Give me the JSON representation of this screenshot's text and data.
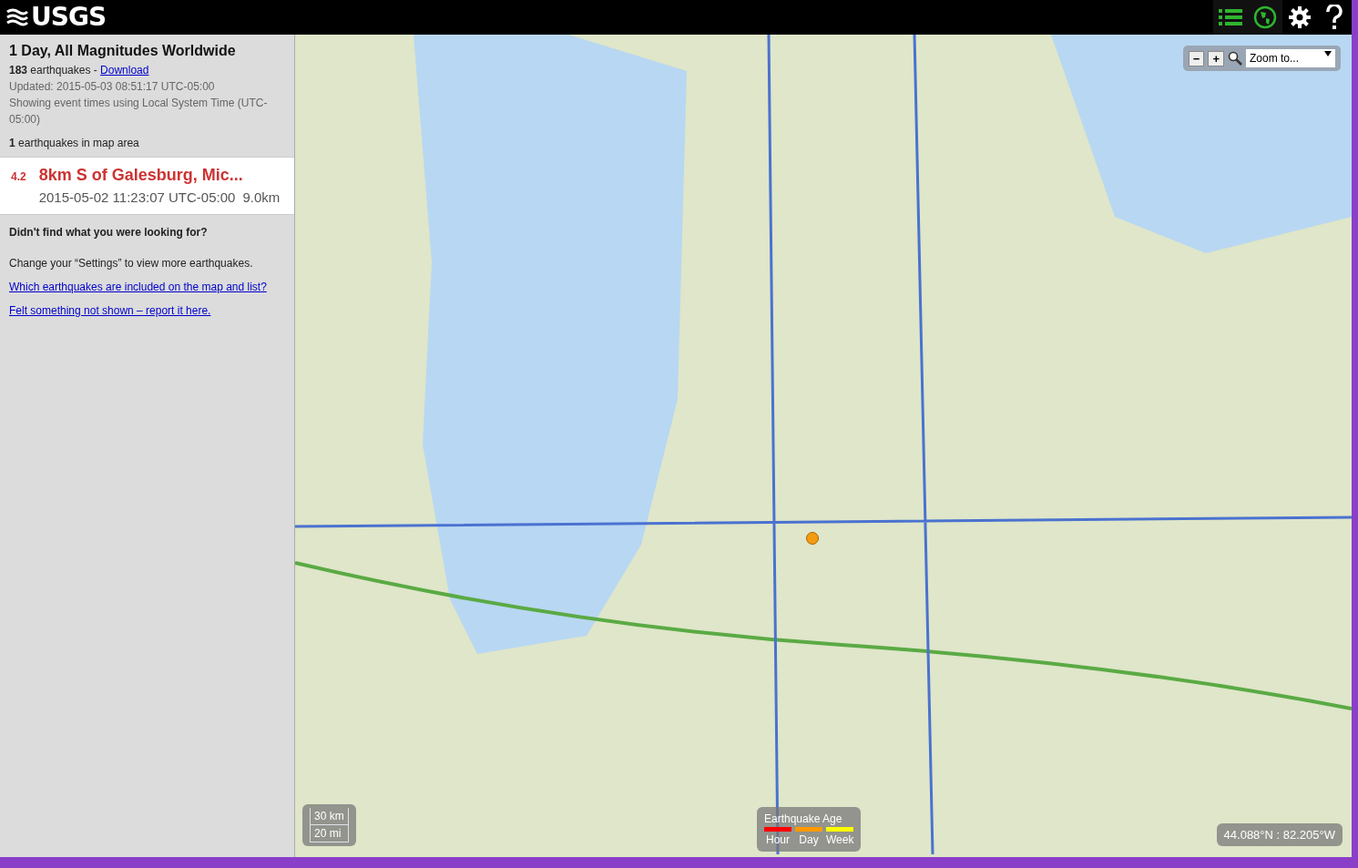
{
  "header": {
    "logo": "USGS",
    "buttons": [
      {
        "kind": "list",
        "active": true
      },
      {
        "kind": "globe",
        "active": true
      },
      {
        "kind": "settings",
        "active": false
      },
      {
        "kind": "help",
        "active": false
      }
    ]
  },
  "sidebar": {
    "title": "1 Day, All Magnitudes Worldwide",
    "count": "183",
    "count_label": "earthquakes - ",
    "download": "Download",
    "updated": "Updated: 2015-05-03 08:51:17 UTC-05:00",
    "time_note": "Showing event times using Local System Time (UTC-05:00)",
    "in_area_count": "1",
    "in_area_label": "earthquakes in map area",
    "events": [
      {
        "magnitude": "4.2",
        "title": "8km S of Galesburg, Mic...",
        "time": "2015-05-02 11:23:07 UTC-05:00",
        "depth": "9.0km",
        "selected": false
      }
    ],
    "help_title": "Didn't find what you were looking for?",
    "help_text": "Change your “Settings” to view more earthquakes.",
    "links": [
      "Which earthquakes are included on the map and list?",
      "Felt something not shown – report it here."
    ]
  },
  "map": {
    "zoom_out": "−",
    "zoom_in": "+",
    "zoom_select": "Zoom to...",
    "scale": [
      "30 km",
      "20 mi"
    ],
    "legend": {
      "title": "Earthquake Age",
      "items": [
        {
          "label": "Hour",
          "color": "#ff0000"
        },
        {
          "label": "Day",
          "color": "#ff9900"
        },
        {
          "label": "Week",
          "color": "#ffff00"
        }
      ]
    },
    "coordinates": "44.088°N : 82.205°W"
  }
}
